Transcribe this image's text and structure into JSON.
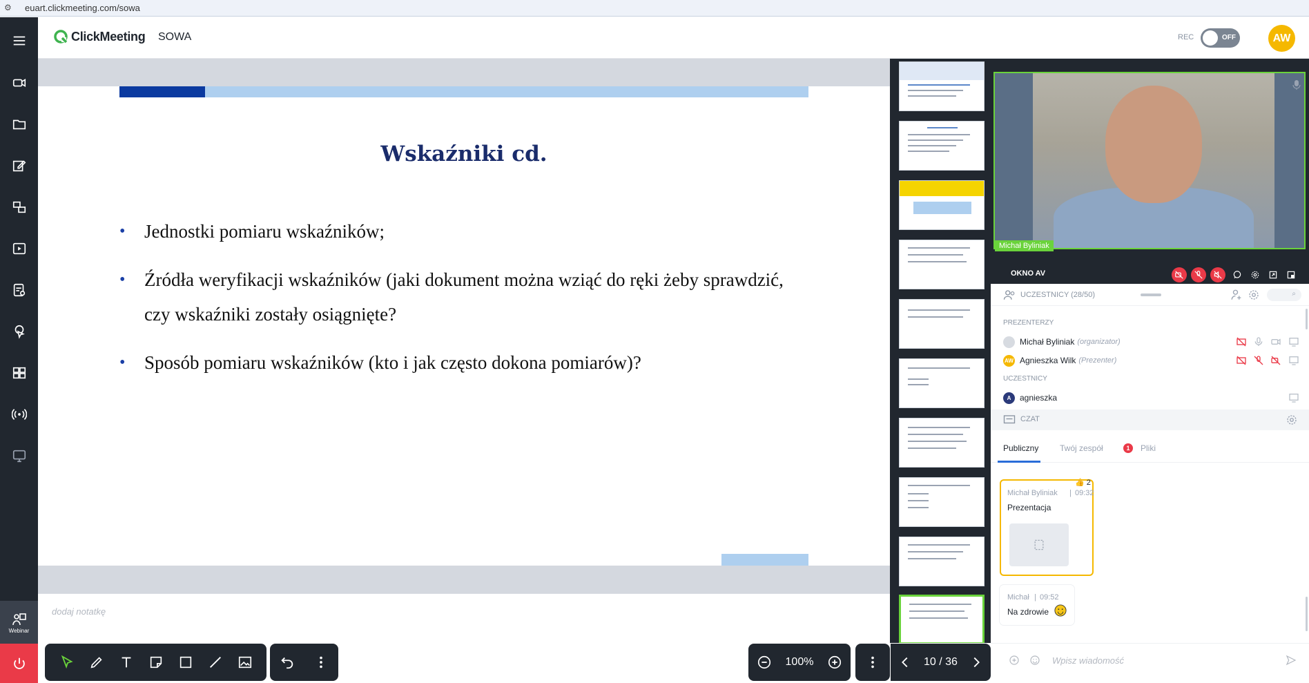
{
  "browser": {
    "url": "euart.clickmeeting.com/sowa"
  },
  "header": {
    "logo_text": "ClickMeeting",
    "room_name": "SOWA",
    "rec_label": "REC",
    "rec_state": "OFF",
    "user_initials": "AW"
  },
  "sidebar": {
    "items": [
      "menu-icon",
      "camera-icon",
      "folder-icon",
      "edit-icon",
      "share-icon",
      "video-file-icon",
      "checklist-icon",
      "cursor-icon",
      "grid-icon",
      "broadcast-icon",
      "screen-share-icon"
    ],
    "bottom_label": "Webinar"
  },
  "slide": {
    "title": "Wskaźniki cd.",
    "bullets": [
      "Jednostki pomiaru wskaźników;",
      "Źródła weryfikacji wskaźników (jaki dokument można wziąć do ręki żeby sprawdzić, czy wskaźniki zostały osiągnięte?",
      "Sposób pomiaru wskaźników (kto i jak często dokona pomiarów)?"
    ]
  },
  "notes": {
    "placeholder": "dodaj notatkę"
  },
  "zoom": {
    "value": "100%"
  },
  "pager": {
    "label": "10 / 36"
  },
  "video": {
    "name_label": "Michał Byliniak"
  },
  "av": {
    "title": "OKNO AV"
  },
  "participants": {
    "header": "UCZESTNICY (28/50)",
    "presenters_label": "PREZENTERZY",
    "attendees_label": "UCZESTNICY",
    "presenters": [
      {
        "name": "Michał Byliniak",
        "role": "(organizator)",
        "initials": "",
        "color": "#d7dbe1"
      },
      {
        "name": "Agnieszka Wilk",
        "role": "(Prezenter)",
        "initials": "AW",
        "color": "#f5b800"
      }
    ],
    "attendees": [
      {
        "name": "agnieszka",
        "initials": "A",
        "color": "#2b3a7a"
      }
    ]
  },
  "chat": {
    "header": "CZAT",
    "tabs": [
      "Publiczny",
      "Twój zespół",
      "Pliki"
    ],
    "files_badge": "1",
    "messages": [
      {
        "author": "Michał Byliniak",
        "time": "09:32",
        "text": "Prezentacja",
        "reaction": "2"
      },
      {
        "author": "Michał",
        "time": "09:52",
        "text": "Na zdrowie"
      }
    ],
    "input_placeholder": "Wpisz wiadomość"
  },
  "colors": {
    "accent_green": "#6ad33b",
    "dark_bg": "#21272f",
    "danger": "#ea3a48",
    "brand_yellow": "#f5b800",
    "slide_blue": "#1a2c6b"
  }
}
